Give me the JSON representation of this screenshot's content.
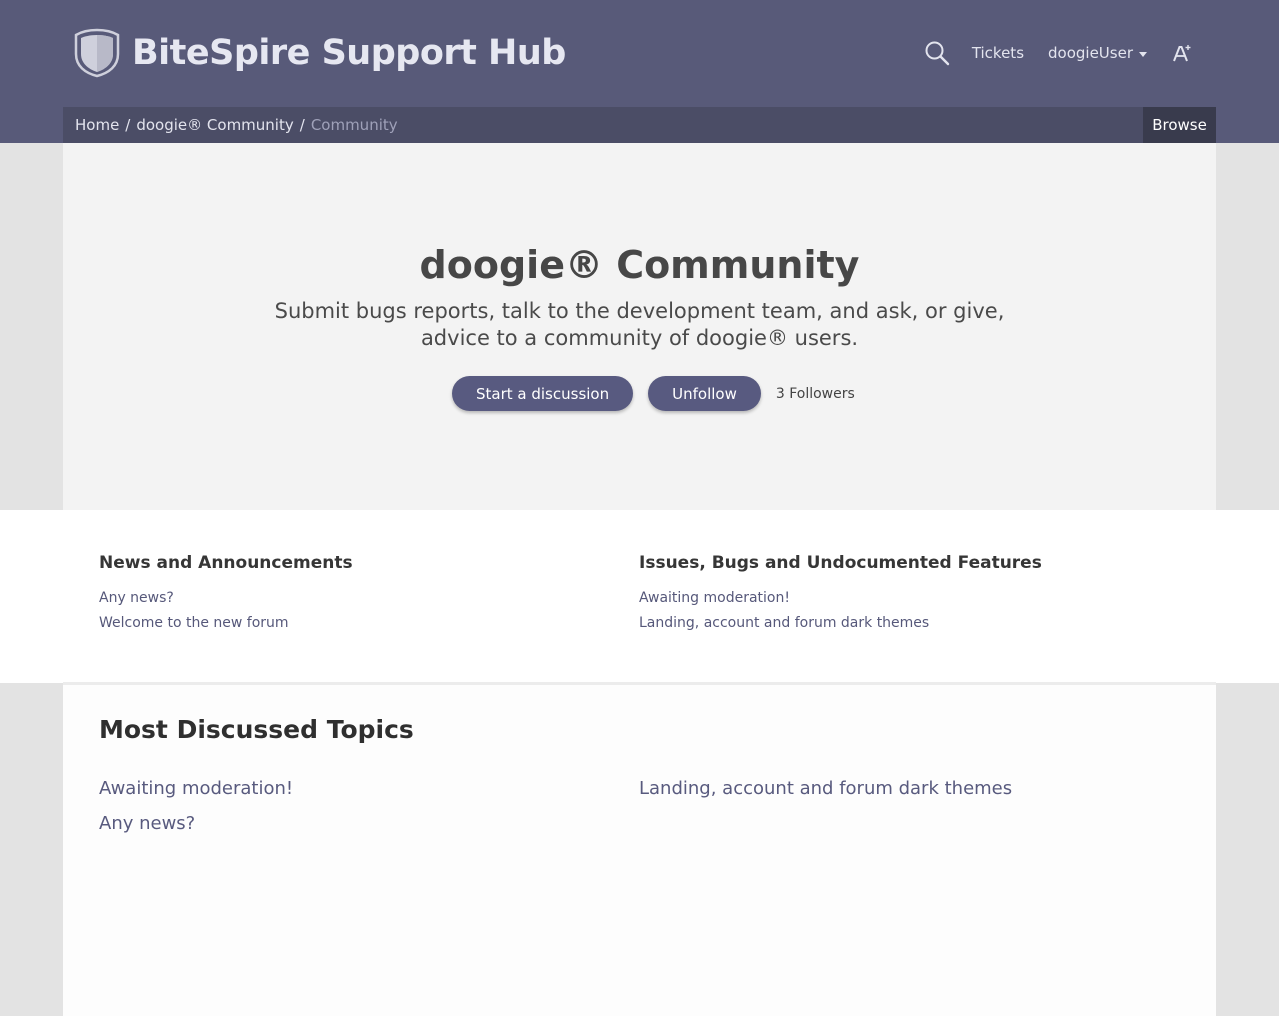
{
  "header": {
    "brand": "BiteSpire Support Hub",
    "nav": {
      "tickets": "Tickets",
      "user": "doogieUser"
    }
  },
  "breadcrumb": {
    "items": [
      "Home",
      "doogie® Community"
    ],
    "separator": "/",
    "current": "Community",
    "browse": "Browse"
  },
  "hero": {
    "title": "doogie® Community",
    "description": "Submit bugs reports, talk to the development team, and ask, or give, advice to a community of doogie® users.",
    "start_discussion": "Start a discussion",
    "unfollow": "Unfollow",
    "followers": "3 Followers"
  },
  "categories": [
    {
      "title": "News and Announcements",
      "links": [
        "Any news?",
        "Welcome to the new forum"
      ]
    },
    {
      "title": "Issues, Bugs and Undocumented Features",
      "links": [
        "Awaiting moderation!",
        "Landing, account and forum dark themes"
      ]
    }
  ],
  "most_discussed": {
    "title": "Most Discussed Topics",
    "topics": [
      "Awaiting moderation!",
      "Landing, account and forum dark themes",
      "Any news?"
    ]
  },
  "colors": {
    "header_bg": "#585a79",
    "crumbbar_bg": "#4b4d66",
    "browse_bg": "#393b4d",
    "button_bg": "#585a80",
    "link": "#56587a"
  },
  "icons": [
    "shield-logo",
    "search-icon",
    "caret-down-icon",
    "font-size-icon"
  ]
}
